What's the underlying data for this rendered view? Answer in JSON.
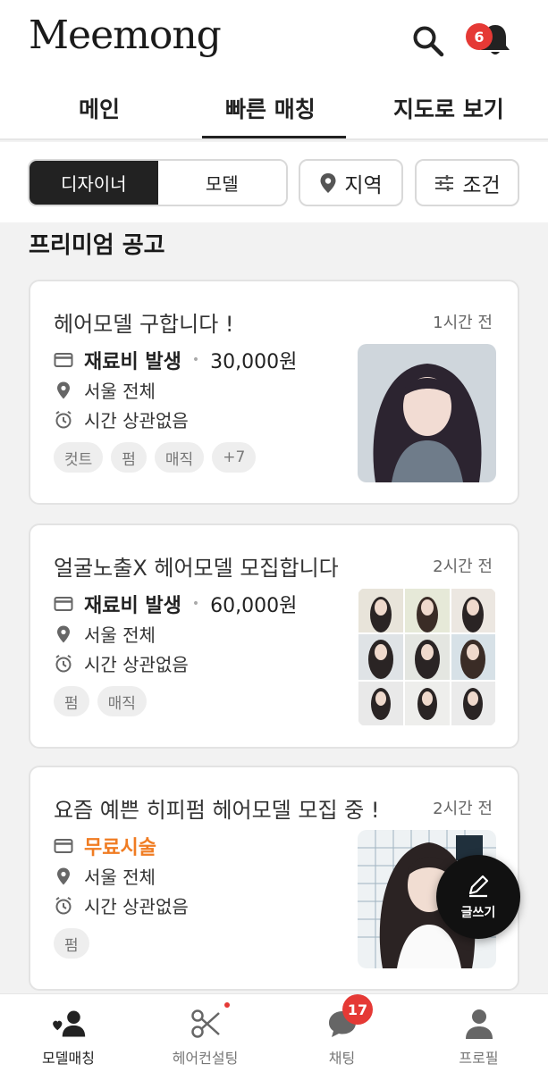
{
  "header": {
    "logo": "Meemong",
    "notification_count": "6"
  },
  "tabs": [
    {
      "label": "메인"
    },
    {
      "label": "빠른 매칭"
    },
    {
      "label": "지도로 보기"
    }
  ],
  "filters": {
    "segment": [
      "디자이너",
      "모델"
    ],
    "region_label": "지역",
    "condition_label": "조건"
  },
  "section_title": "프리미엄 공고",
  "cards": [
    {
      "title": "헤어모델 구합니다 !",
      "time": "1시간 전",
      "price_label": "재료비 발생",
      "price_dot": "•",
      "amount": "30,000원",
      "location": "서울 전체",
      "time_condition": "시간 상관없음",
      "tags": [
        "컷트",
        "펌",
        "매직",
        "+7"
      ]
    },
    {
      "title": "얼굴노출X 헤어모델 모집합니다",
      "time": "2시간 전",
      "price_label": "재료비 발생",
      "price_dot": "•",
      "amount": "60,000원",
      "location": "서울 전체",
      "time_condition": "시간 상관없음",
      "tags": [
        "펌",
        "매직"
      ]
    },
    {
      "title": "요즘 예쁜 히피펌 헤어모델 모집 중 !",
      "time": "2시간 전",
      "price_label": "무료시술",
      "location": "서울 전체",
      "time_condition": "시간 상관없음",
      "tags": [
        "펌"
      ]
    }
  ],
  "fab": {
    "label": "글쓰기"
  },
  "bottom_nav": [
    {
      "label": "모델매칭",
      "icon": "person-heart-icon"
    },
    {
      "label": "헤어컨설팅",
      "icon": "scissors-icon"
    },
    {
      "label": "채팅",
      "icon": "chat-bubble-icon",
      "badge": "17"
    },
    {
      "label": "프로필",
      "icon": "profile-icon"
    }
  ],
  "colors": {
    "accent_red": "#e53935",
    "free_orange": "#f07c22",
    "dark": "#222222"
  }
}
